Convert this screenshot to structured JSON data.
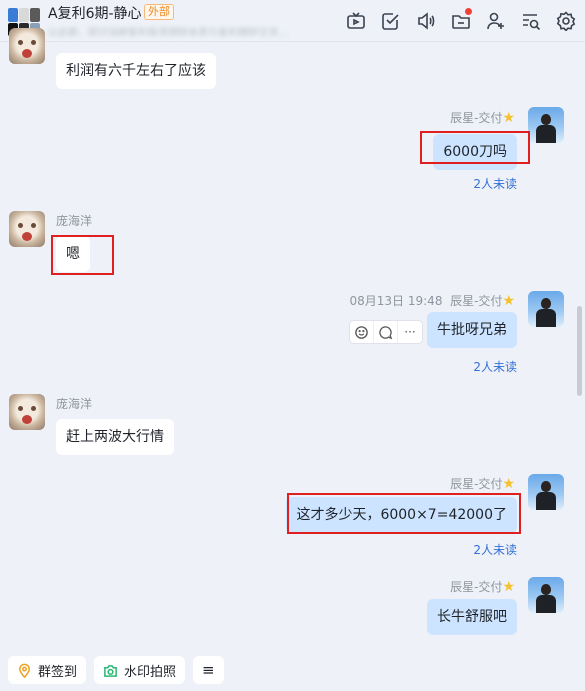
{
  "header": {
    "title": "A复利6期-静心",
    "external_badge": "外部",
    "subtitle": "以此群，研讨深耕复利投资理财本质与复利理财交流…",
    "icons": [
      "tv-icon",
      "checkbox-icon",
      "speaker-icon",
      "folder-icon",
      "add-user-icon",
      "search-list-icon",
      "gear-icon"
    ]
  },
  "messages": [
    {
      "side": "left",
      "text": "利润有六千左右了应该"
    },
    {
      "side": "right",
      "sender": "辰星-交付",
      "text": "6000刀吗",
      "read": "2人未读",
      "highlighted": true
    },
    {
      "side": "left",
      "sender": "庞海洋",
      "text": "嗯",
      "highlighted": true
    },
    {
      "side": "right",
      "time": "08月13日 19:48",
      "sender": "辰星-交付",
      "text": "牛批呀兄弟",
      "read": "2人未读"
    },
    {
      "side": "left",
      "sender": "庞海洋",
      "text": "赶上两波大行情"
    },
    {
      "side": "right",
      "sender": "辰星-交付",
      "text": "这才多少天，6000×7=42000了",
      "read": "2人未读",
      "highlighted": true
    },
    {
      "side": "right",
      "sender": "辰星-交付",
      "text": "长牛舒服吧"
    }
  ],
  "hover_actions": {
    "more": "···"
  },
  "quickbar": {
    "checkin": "群签到",
    "watermark_photo": "水印拍照",
    "menu_glyph": "≡"
  },
  "colors": {
    "background": "#eef1f8",
    "bubble_self": "#cce4ff",
    "bubble_other": "#ffffff",
    "read_link": "#3370d8",
    "highlight": "#e02020",
    "external": "#f08a24"
  }
}
